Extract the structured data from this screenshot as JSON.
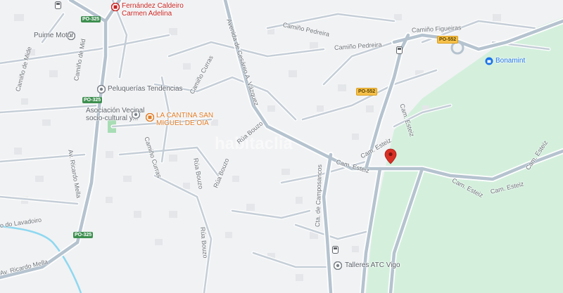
{
  "map": {
    "places": [
      {
        "id": "fernandez",
        "line1": "Fernández Caldeiro",
        "line2": "Carmen Adelina",
        "kind": "red"
      },
      {
        "id": "puime",
        "line1": "Puime Motor",
        "kind": "gray"
      },
      {
        "id": "peluquerias",
        "line1": "Peluquerías Tendencias",
        "kind": "gray"
      },
      {
        "id": "asociacion",
        "line1": "Asociación Vecinal",
        "line2": "socio-cultural y...",
        "kind": "gray"
      },
      {
        "id": "cantina",
        "line1": "LA CANTINA SAN",
        "line2": "MIGUEL DE OIA",
        "kind": "orange"
      },
      {
        "id": "bonamint",
        "line1": "Bonamint",
        "kind": "blue"
      },
      {
        "id": "talleres",
        "line1": "Talleres ATC Vigo",
        "kind": "gray"
      }
    ],
    "streets": {
      "camino_pedreira_1": "Camiño Pedreira",
      "camino_pedreira_2": "Camiño Pedreira",
      "camino_figueiras": "Camiño Figueiras",
      "avenida_cesareo": "Avenida de Cesáreo A. Vázquez",
      "camino_mide": "Camiño de Mide",
      "camino_mid_upper": "Camiño de Mid",
      "camino_curras_1": "Camiño Curras",
      "camino_curras_2": "Camiño Curras",
      "rua_bouzo_1": "Rúa Bouzo",
      "rua_bouzo_2": "Rúa Bouzo",
      "rua_bouzo_3": "Rúa Bouzo",
      "rua_bouzo_4": "Rúa Bouzo",
      "av_ricardo_mella_1": "Av. Ricardo Mella",
      "av_ricardo_mella_2": "Av. Ricardo Mella",
      "camino_lavadoiro": "o do Lavadoiro",
      "cam_esteiz_1": "Cam. Esteiz",
      "cam_esteiz_2": "Cam. Esteiz",
      "cam_esteiz_3": "Cam. Esteiz",
      "cam_esteiz_4": "Cam. Esteiz",
      "cam_esteiz_5": "Cam. Esteiz",
      "cam_esteiz_6": "Cam. Esteiz",
      "cam_esteiz_7": "Cam. Esteiz",
      "cta_camposancos": "Cta. de Camposancos"
    },
    "road_badges": [
      {
        "id": "po325_top",
        "text": "PO-325",
        "color": "green"
      },
      {
        "id": "po325_mid",
        "text": "PO-325",
        "color": "green"
      },
      {
        "id": "po325_low",
        "text": "PO-325",
        "color": "green"
      },
      {
        "id": "po552_top",
        "text": "PO-552",
        "color": "yellow"
      },
      {
        "id": "po552_mid",
        "text": "PO-552",
        "color": "yellow"
      }
    ],
    "watermark": "habitaclia",
    "colors": {
      "background": "#f1f2f4",
      "road": "#b5c3cf",
      "road_outline": "#ffffff",
      "park": "#d4f0dd",
      "water": "#8ed8f0",
      "pin": "#d93025",
      "route": "#c0cad4"
    }
  }
}
